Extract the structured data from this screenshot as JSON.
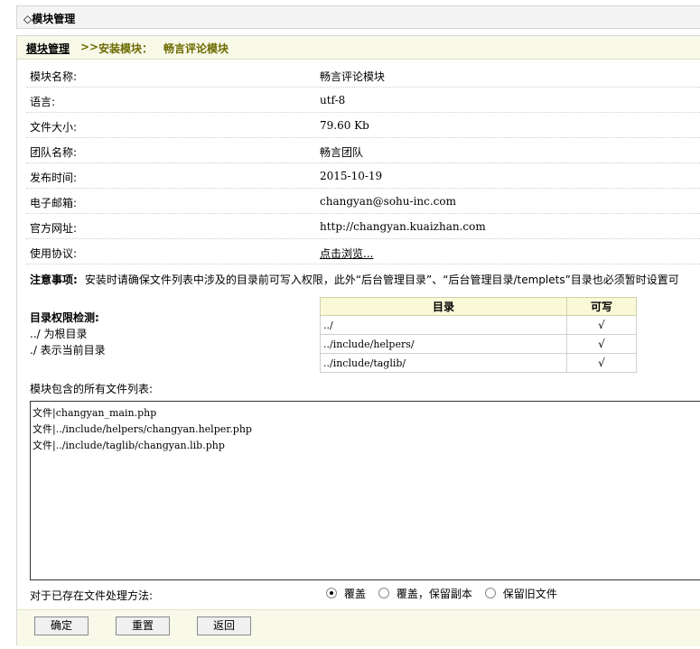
{
  "header": {
    "title": "◇模块管理"
  },
  "breadcrumb": {
    "home": "模块管理",
    "separator": ">>",
    "step": "安装模块：",
    "module": "畅言评论模块"
  },
  "info": [
    {
      "label": "模块名称:",
      "value": "畅言评论模块"
    },
    {
      "label": "语言:",
      "value": "utf-8"
    },
    {
      "label": "文件大小:",
      "value": "79.60 Kb"
    },
    {
      "label": "团队名称:",
      "value": "畅言团队"
    },
    {
      "label": "发布时间:",
      "value": "2015-10-19"
    },
    {
      "label": "电子邮箱:",
      "value": "changyan@sohu-inc.com"
    },
    {
      "label": "官方网址:",
      "value": "http://changyan.kuaizhan.com"
    },
    {
      "label": "使用协议:",
      "value": "点击浏览..."
    }
  ],
  "notice": {
    "label": "注意事项:",
    "text": "安装时请确保文件列表中涉及的目录前可写入权限，此外“后台管理目录”、“后台管理目录/templets”目录也必须暂时设置可"
  },
  "dir_check": {
    "title": "目录权限检测:",
    "hint1": "../ 为根目录",
    "hint2": "./ 表示当前目录",
    "headers": {
      "dir": "目录",
      "writable": "可写"
    },
    "rows": [
      {
        "dir": "../",
        "ok": "√"
      },
      {
        "dir": "../include/helpers/",
        "ok": "√"
      },
      {
        "dir": "../include/taglib/",
        "ok": "√"
      }
    ]
  },
  "files": {
    "label": "模块包含的所有文件列表:",
    "lines": [
      "文件|changyan_main.php",
      "文件|../include/helpers/changyan.helper.php",
      "文件|../include/taglib/changyan.lib.php"
    ]
  },
  "existing": {
    "label": "对于已存在文件处理方法:",
    "options": [
      "覆盖",
      "覆盖，保留副本",
      "保留旧文件"
    ],
    "selected": 0
  },
  "buttons": {
    "confirm": "确定",
    "reset": "重置",
    "back": "返回"
  }
}
